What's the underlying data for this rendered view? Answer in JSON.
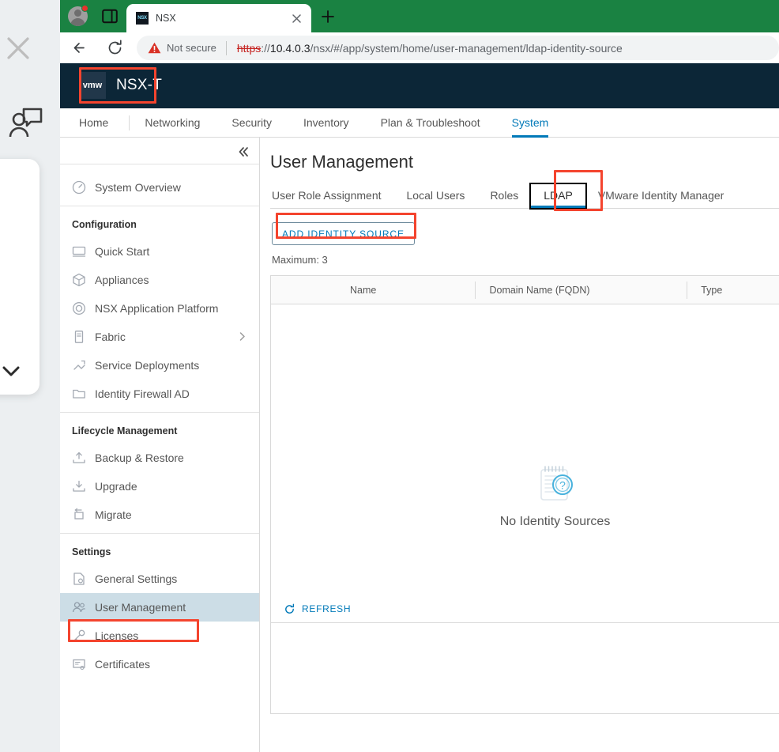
{
  "overlay": {
    "close_icon": "close-icon",
    "person_icon": "person-chat-icon",
    "chevron_icon": "chevron-down-icon"
  },
  "browser": {
    "profile_avatar": "avatar",
    "notification_dot": "notification-dot",
    "tab_list_icon": "tab-list-icon",
    "tab": {
      "favicon_text": "NSX",
      "title": "NSX",
      "close_icon": "close-icon"
    },
    "new_tab_icon": "plus-icon",
    "back_icon": "back-arrow-icon",
    "reload_icon": "reload-icon",
    "security": {
      "warning_icon": "warning-triangle-icon",
      "label": "Not secure"
    },
    "url": {
      "scheme": "https",
      "host": "10.4.0.3",
      "path": "/nsx/#/app/system/home/user-management/ldap-identity-source",
      "separator": "://"
    },
    "green_accent": "#1a8242"
  },
  "app": {
    "header": {
      "logo_text": "vmw",
      "product_name": "NSX-T",
      "background": "#0c2637"
    },
    "nav_tabs": [
      {
        "label": "Home",
        "active": false
      },
      {
        "label": "Networking",
        "active": false
      },
      {
        "label": "Security",
        "active": false
      },
      {
        "label": "Inventory",
        "active": false
      },
      {
        "label": "Plan & Troubleshoot",
        "active": false
      },
      {
        "label": "System",
        "active": true
      }
    ],
    "accent_blue": "#0079b8"
  },
  "sidebar": {
    "collapse_icon": "double-chevron-left-icon",
    "groups": [
      {
        "heading": null,
        "items": [
          {
            "label": "System Overview",
            "icon": "dashboard-icon",
            "selected": false,
            "has_arrow": false
          }
        ]
      },
      {
        "heading": "Configuration",
        "items": [
          {
            "label": "Quick Start",
            "icon": "monitor-icon",
            "selected": false,
            "has_arrow": false
          },
          {
            "label": "Appliances",
            "icon": "cube-icon",
            "selected": false,
            "has_arrow": false
          },
          {
            "label": "NSX Application Platform",
            "icon": "platform-icon",
            "selected": false,
            "has_arrow": false
          },
          {
            "label": "Fabric",
            "icon": "server-icon",
            "selected": false,
            "has_arrow": true
          },
          {
            "label": "Service Deployments",
            "icon": "deployment-icon",
            "selected": false,
            "has_arrow": false
          },
          {
            "label": "Identity Firewall AD",
            "icon": "folder-icon",
            "selected": false,
            "has_arrow": false
          }
        ]
      },
      {
        "heading": "Lifecycle Management",
        "items": [
          {
            "label": "Backup & Restore",
            "icon": "backup-icon",
            "selected": false,
            "has_arrow": false
          },
          {
            "label": "Upgrade",
            "icon": "upgrade-icon",
            "selected": false,
            "has_arrow": false
          },
          {
            "label": "Migrate",
            "icon": "migrate-icon",
            "selected": false,
            "has_arrow": false
          }
        ]
      },
      {
        "heading": "Settings",
        "items": [
          {
            "label": "General Settings",
            "icon": "settings-page-icon",
            "selected": false,
            "has_arrow": false
          },
          {
            "label": "User Management",
            "icon": "users-icon",
            "selected": true,
            "has_arrow": false
          },
          {
            "label": "Licenses",
            "icon": "key-icon",
            "selected": false,
            "has_arrow": false
          },
          {
            "label": "Certificates",
            "icon": "certificate-icon",
            "selected": false,
            "has_arrow": false
          }
        ]
      }
    ]
  },
  "main": {
    "title": "User Management",
    "tabs": [
      {
        "label": "User Role Assignment",
        "active": false
      },
      {
        "label": "Local Users",
        "active": false
      },
      {
        "label": "Roles",
        "active": false
      },
      {
        "label": "LDAP",
        "active": true
      },
      {
        "label": "VMware Identity Manager",
        "active": false
      }
    ],
    "add_button": "ADD IDENTITY SOURCE",
    "maximum_label": "Maximum: 3",
    "table": {
      "columns": [
        "Name",
        "Domain Name (FQDN)",
        "Type"
      ],
      "rows": [],
      "empty_icon": "no-results-icon",
      "empty_message": "No Identity Sources"
    },
    "footer": {
      "refresh_icon": "refresh-icon",
      "refresh_label": "REFRESH"
    }
  },
  "annotations": {
    "color": "#f4442e",
    "boxes": [
      "nsx-t-logo",
      "ldap-tab",
      "add-identity-source-button",
      "user-management-sidebar-item"
    ]
  }
}
